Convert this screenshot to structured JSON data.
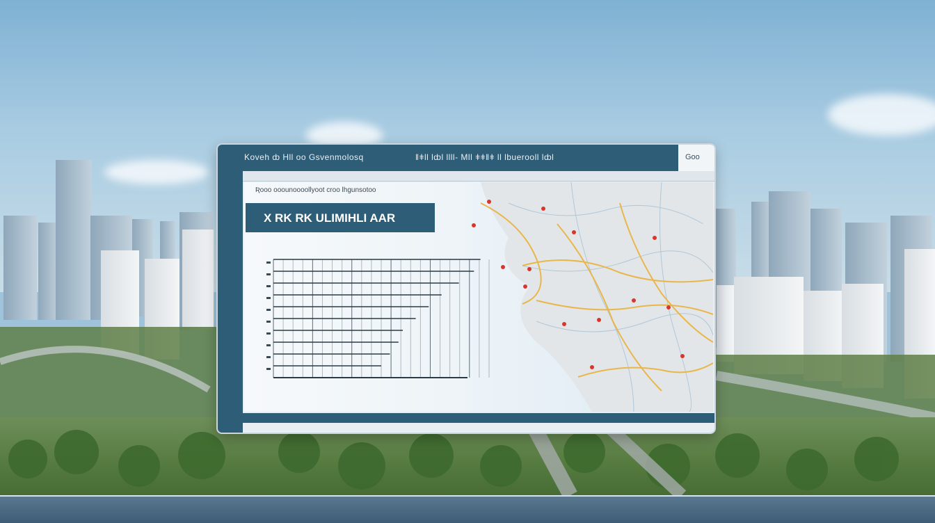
{
  "scene": {
    "sky_color": "#9fc3da",
    "panel_accent": "#2e5d78",
    "route_color": "#e8b64a",
    "marker_color": "#d9362b"
  },
  "panel": {
    "title_left": "Koveh ȸ  Hll oo Gsvenmolosq",
    "title_right": "ǁǂll lȸl  llll- Mll ǂǂǁǂ ll lbuerooll lȸl",
    "title_end": "Goo",
    "subtitle": "Ʀooo ooounoooollyoot croo lhgunsotoo",
    "header": "X RK  RK ULIMIHLI AAR"
  },
  "chart": {
    "bar_fractions": [
      0.96,
      0.93,
      0.86,
      0.78,
      0.72,
      0.66,
      0.6,
      0.58,
      0.54,
      0.5
    ]
  }
}
